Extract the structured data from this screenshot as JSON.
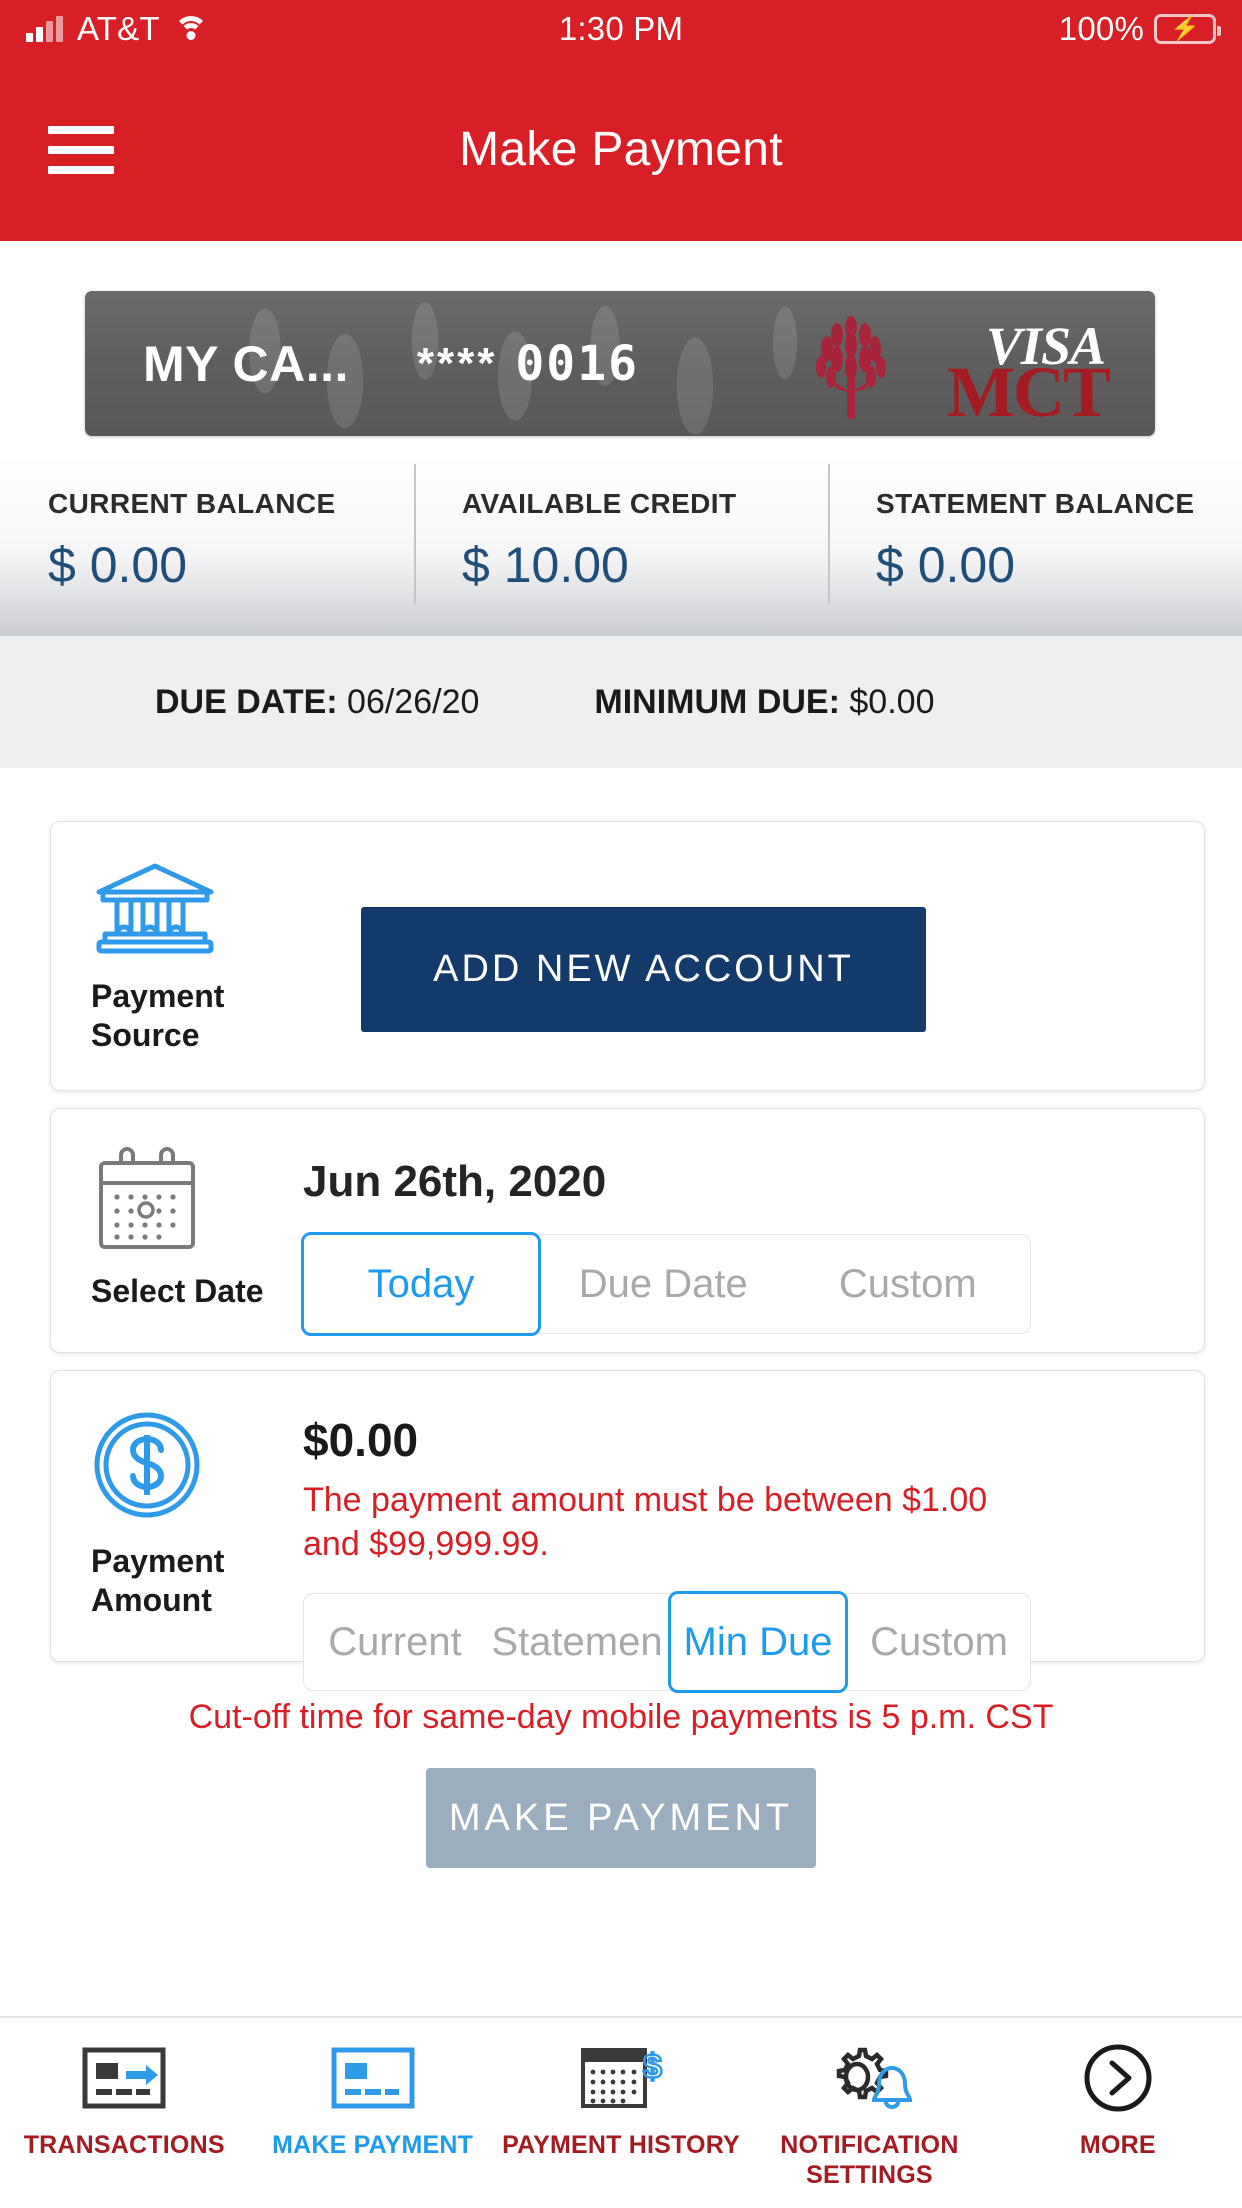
{
  "status_bar": {
    "carrier": "AT&T",
    "time": "1:30 PM",
    "battery_percent": "100%",
    "signal_icon": "signal-bars-icon",
    "wifi_icon": "wifi-icon",
    "battery_icon": "battery-charging-icon"
  },
  "nav": {
    "menu_icon": "hamburger-menu-icon",
    "title": "Make Payment"
  },
  "card": {
    "nickname": "MY CA...",
    "mask_stars": "****",
    "last_four": "0016",
    "network": "VISA",
    "brand": "MCT",
    "tree_icon": "tree-logo-icon"
  },
  "balances": [
    {
      "label": "CURRENT BALANCE",
      "value": "$ 0.00"
    },
    {
      "label": "AVAILABLE CREDIT",
      "value": "$ 10.00"
    },
    {
      "label": "STATEMENT BALANCE",
      "value": "$ 0.00"
    }
  ],
  "due": {
    "due_date_label": "DUE DATE:",
    "due_date_value": "06/26/20",
    "minimum_due_label": "MINIMUM DUE:",
    "minimum_due_value": "$0.00"
  },
  "payment_source": {
    "icon": "bank-building-icon",
    "label": "Payment Source",
    "add_button": "ADD NEW ACCOUNT"
  },
  "select_date": {
    "icon": "calendar-icon",
    "label": "Select Date",
    "date": "Jun 26th, 2020",
    "options": [
      "Today",
      "Due Date",
      "Custom"
    ],
    "selected": "Today"
  },
  "payment_amount": {
    "icon": "dollar-coin-icon",
    "label": "Payment Amount",
    "amount": "$0.00",
    "error": "The payment amount must be between $1.00 and $99,999.99.",
    "options": [
      "Current",
      "Statemen",
      "Min Due",
      "Custom"
    ],
    "selected": "Min Due"
  },
  "cutoff_notice": "Cut-off time for same-day mobile payments is 5 p.m. CST",
  "make_payment_button": "MAKE PAYMENT",
  "tabs": [
    {
      "label": "TRANSACTIONS",
      "icon": "card-arrow-icon",
      "active": false
    },
    {
      "label": "MAKE PAYMENT",
      "icon": "card-blue-icon",
      "active": true
    },
    {
      "label": "PAYMENT HISTORY",
      "icon": "calendar-dollar-icon",
      "active": false
    },
    {
      "label": "NOTIFICATION SETTINGS",
      "icon": "gear-bell-icon",
      "active": false
    },
    {
      "label": "MORE",
      "icon": "chevron-right-circle-icon",
      "active": false
    }
  ],
  "colors": {
    "brand_red": "#D81F26",
    "accent_blue": "#1E9BEA",
    "navy": "#123A6B",
    "balance_blue": "#1F4E79",
    "tab_red": "#A41B22",
    "disabled_button": "#9BAEC0"
  }
}
